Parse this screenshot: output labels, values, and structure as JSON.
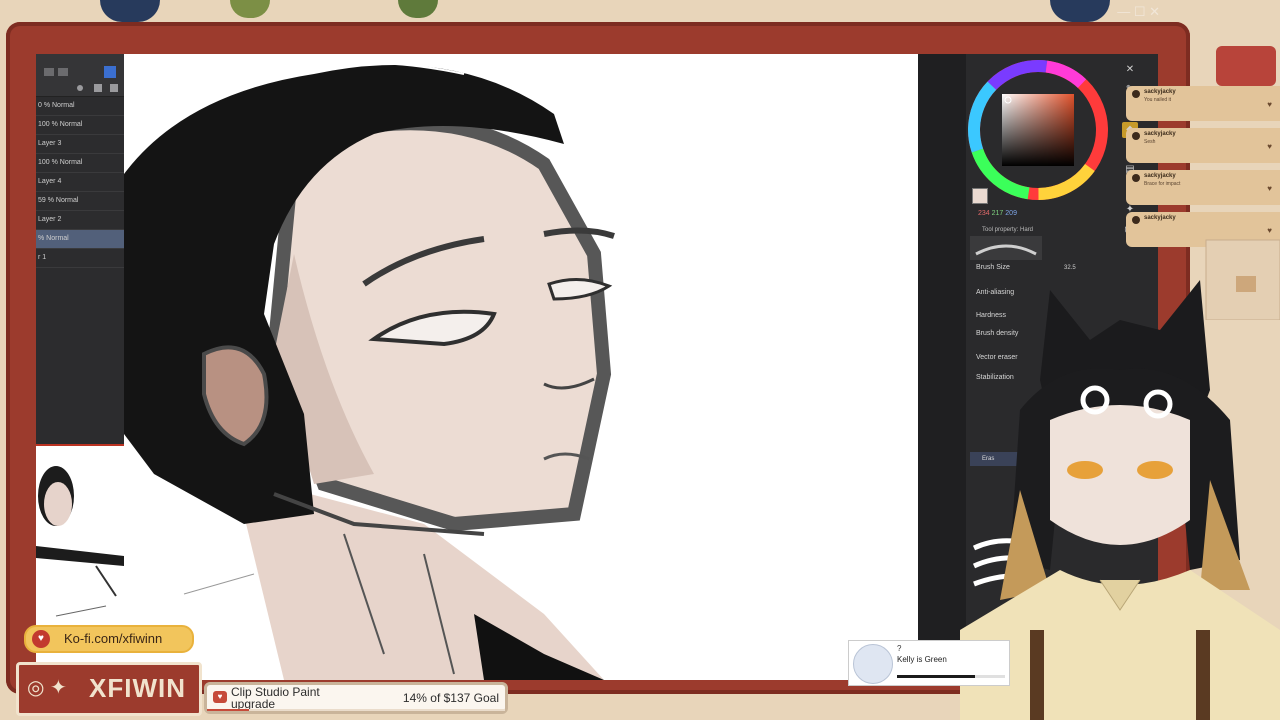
{
  "window_controls": {
    "minimize": "—",
    "maximize": "☐",
    "close": "✕"
  },
  "layers": [
    {
      "label": "0 % Normal",
      "selected": false
    },
    {
      "label": "100 % Normal",
      "selected": false
    },
    {
      "label": "Layer 3",
      "selected": false
    },
    {
      "label": "100 % Normal",
      "selected": false
    },
    {
      "label": "Layer 4",
      "selected": false
    },
    {
      "label": "59 % Normal",
      "selected": false
    },
    {
      "label": "Layer 2",
      "selected": false
    },
    {
      "label": "% Normal",
      "selected": true
    },
    {
      "label": "r 1",
      "selected": false
    }
  ],
  "color_panel": {
    "r": "234",
    "g": "217",
    "b": "209",
    "current_color": "#eadad1",
    "accent": "#4a4a4a"
  },
  "tool_property": {
    "title": "Tool property: Hard",
    "rows": [
      {
        "label": "Brush Size",
        "value": "32.5"
      },
      {
        "label": "Anti-aliasing",
        "value": ""
      },
      {
        "label": "Hardness",
        "value": ""
      },
      {
        "label": "Brush density",
        "value": ""
      },
      {
        "label": "Vector eraser",
        "value": ""
      },
      {
        "label": "Stabilization",
        "value": ""
      }
    ],
    "sub_tool_tab": "Eras"
  },
  "chat": [
    {
      "user": "sackyjacky",
      "text": "You nailed it"
    },
    {
      "user": "sackyjacky",
      "text": "Sesh"
    },
    {
      "user": "sackyjacky",
      "text": "Brace for impact"
    },
    {
      "user": "sackyjacky",
      "text": ""
    }
  ],
  "now_playing": {
    "prefix": "?",
    "title": "Kelly is Green",
    "progress": 0.72
  },
  "kofi": {
    "label": "Ko-fi.com/xfiwinn"
  },
  "social": {
    "handle": "XFIWIN"
  },
  "goal": {
    "name": "Clip Studio Paint upgrade",
    "percent_text": "14% of $137 Goal",
    "progress": 0.14
  },
  "brand_color": "#9c3b2d"
}
